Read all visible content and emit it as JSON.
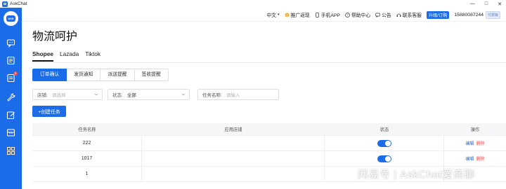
{
  "window": {
    "app_title": "AskChat",
    "controls": [
      "—",
      "□",
      "✕"
    ]
  },
  "topbar": {
    "language": "中文",
    "promo": "推广返现",
    "mobile_app": "手机APP",
    "help": "帮助中心",
    "announcement": "公告",
    "support": "联系客服",
    "upgrade": "升级/订购",
    "phone": "15880087244",
    "plan_badge": "付费版"
  },
  "page": {
    "title": "物流呵护",
    "platform_tabs": [
      "Shopee",
      "Lazada",
      "Tiktok"
    ],
    "sub_tabs": [
      "订单确认",
      "发货通知",
      "派送提醒",
      "签收提醒"
    ]
  },
  "filters": {
    "store": {
      "label": "店铺:",
      "placeholder": "请选择"
    },
    "status": {
      "label": "状态:",
      "value": "全部"
    },
    "task_name": {
      "label": "任务名称:",
      "placeholder": "请输入"
    }
  },
  "create_button": "+创建任务",
  "table": {
    "headers": [
      "任务名称",
      "应用店铺",
      "状态",
      "操作"
    ],
    "rows": [
      {
        "name": "222",
        "store": "",
        "edit": "编辑",
        "delete": "删除"
      },
      {
        "name": "1017",
        "store": "",
        "edit": "编辑",
        "delete": "删除"
      },
      {
        "name": "1",
        "store": "",
        "edit": "",
        "delete": ""
      }
    ]
  },
  "watermark": "网易号 | AskChat爱商聊",
  "sidebar": {
    "logo_text": "ASK",
    "badge_count": "1"
  },
  "colors": {
    "accent": "#1a6ce8",
    "danger": "#f24b4b"
  }
}
